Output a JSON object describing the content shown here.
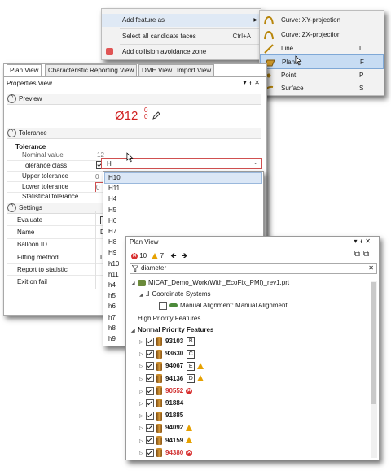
{
  "context_menu": {
    "items": [
      {
        "label": "Add feature as",
        "shortcut": ""
      },
      {
        "label": "Select all candidate faces",
        "shortcut": "Ctrl+A"
      },
      {
        "label": "Add collision avoidance zone",
        "shortcut": ""
      }
    ]
  },
  "submenu": {
    "items": [
      {
        "label": "Curve: XY-projection",
        "shortcut": ""
      },
      {
        "label": "Curve: ZX-projection",
        "shortcut": ""
      },
      {
        "label": "Line",
        "shortcut": "L"
      },
      {
        "label": "Plane",
        "shortcut": "F"
      },
      {
        "label": "Point",
        "shortcut": "P"
      },
      {
        "label": "Surface",
        "shortcut": "S"
      }
    ]
  },
  "props": {
    "tabs": [
      "Plan View",
      "Characteristic Reporting View",
      "DME View",
      "Import View"
    ],
    "title": "Properties View",
    "preview_label": "Preview",
    "preview_symbol": "Ø12",
    "tol_upper": "0",
    "tol_lower": "0",
    "tolerance_section": "Tolerance",
    "tolerance_header": "Tolerance",
    "nominal_label": "Nominal value",
    "nominal_value": "12",
    "class_label": "Tolerance class",
    "class_value": "H",
    "upper_label": "Upper tolerance",
    "upper_value": "0",
    "lower_label": "Lower tolerance",
    "lower_value": "0",
    "statistical_label": "Statistical tolerance",
    "settings_section": "Settings",
    "evaluate_label": "Evaluate",
    "name_label": "Name",
    "name_value": "D",
    "balloon_label": "Balloon ID",
    "fitting_label": "Fitting method",
    "fitting_value": "L",
    "report_label": "Report to statistic",
    "exit_label": "Exit on fail"
  },
  "dropdown": [
    "H10",
    "H11",
    "H4",
    "H5",
    "H6",
    "H7",
    "H8",
    "H9",
    "h10",
    "h11",
    "h4",
    "h5",
    "h6",
    "h7",
    "h8",
    "h9"
  ],
  "plan": {
    "title": "Plan View",
    "error_count": "10",
    "warning_count": "7",
    "search_value": "diameter",
    "file_node": "MiCAT_Demo_Work(With_EcoFix_PMI)_rev1.prt",
    "coord_node": "Coordinate Systems",
    "manual_node": "Manual Alignment: Manual Alignment",
    "high_priority": "High Priority Features",
    "normal_priority": "Normal Priority Features",
    "features": [
      {
        "id": "93103",
        "datum": "B",
        "status": ""
      },
      {
        "id": "93630",
        "datum": "C",
        "status": ""
      },
      {
        "id": "94067",
        "datum": "E",
        "status": "warn"
      },
      {
        "id": "94136",
        "datum": "D",
        "status": "warn"
      },
      {
        "id": "90552",
        "datum": "",
        "status": "error"
      },
      {
        "id": "91884",
        "datum": "",
        "status": ""
      },
      {
        "id": "91885",
        "datum": "",
        "status": ""
      },
      {
        "id": "94092",
        "datum": "",
        "status": "warn"
      },
      {
        "id": "94159",
        "datum": "",
        "status": "warn"
      },
      {
        "id": "94380",
        "datum": "",
        "status": "error"
      }
    ]
  }
}
